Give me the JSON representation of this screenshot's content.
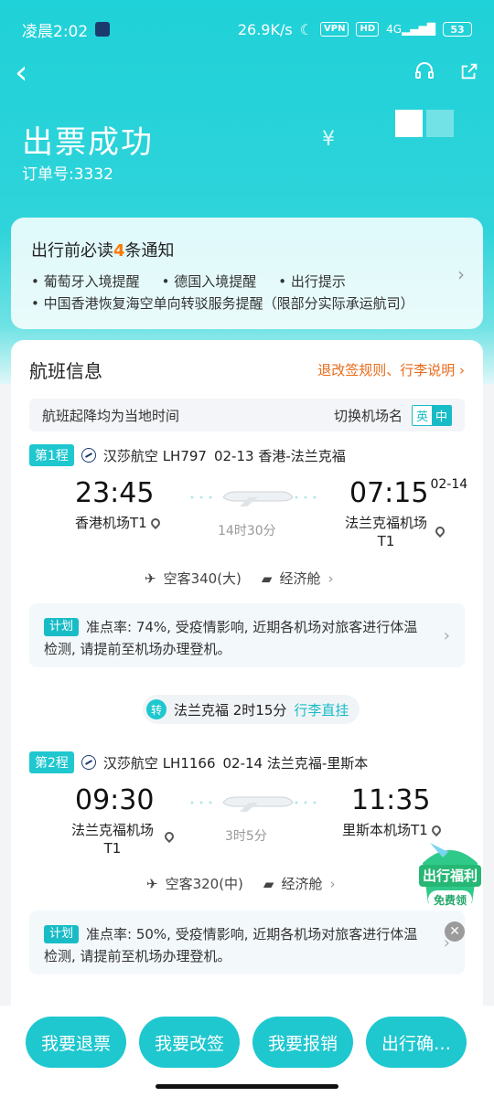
{
  "status_bar": {
    "time": "凌晨2:02",
    "speed": "26.9K/s",
    "vpn": "VPN",
    "hd": "HD",
    "network": "4G",
    "battery": "53"
  },
  "header": {
    "title": "出票成功",
    "order_label": "订单号:3332",
    "price_symbol": "¥"
  },
  "notice": {
    "title_prefix": "出行前必读",
    "title_count": "4",
    "title_suffix": "条通知",
    "items": [
      "• 葡萄牙入境提醒",
      "• 德国入境提醒",
      "• 出行提示"
    ],
    "item_long": "• 中国香港恢复海空单向转驳服务提醒（限部分实际承运航司）"
  },
  "flight_card": {
    "title": "航班信息",
    "rules_link": "退改签规则、行李说明 ›",
    "tip": "航班起降均为当地时间",
    "switch_label": "切换机场名",
    "lang_en": "英",
    "lang_zh": "中"
  },
  "legs": [
    {
      "tag": "第1程",
      "airline": "汉莎航空 LH797",
      "date_route": "02-13 香港-法兰克福",
      "dep_time": "23:45",
      "arr_time": "07:15",
      "arr_date": "02-14",
      "dep_airport": "香港机场T1",
      "arr_airport_line1": "法兰克福机场",
      "arr_airport_line2": "T1",
      "duration": "14时30分",
      "aircraft": "空客340(大)",
      "cabin": "经济舱",
      "plan_tag": "计划",
      "plan_text": "准点率: 74%, 受疫情影响, 近期各机场对旅客进行体温检测, 请提前至机场办理登机。"
    },
    {
      "tag": "第2程",
      "airline": "汉莎航空 LH1166",
      "date_route": "02-14 法兰克福-里斯本",
      "dep_time": "09:30",
      "arr_time": "11:35",
      "dep_airport_line1": "法兰克福机场",
      "dep_airport_line2": "T1",
      "arr_airport": "里斯本机场T1",
      "duration": "3时5分",
      "aircraft": "空客320(中)",
      "cabin": "经济舱",
      "plan_tag": "计划",
      "plan_text": "准点率: 50%, 受疫情影响, 近期各机场对旅客进行体温检测, 请提前至机场办理登机。"
    }
  ],
  "transfer": {
    "icon_text": "转",
    "text": "法兰克福 2时15分",
    "bag": "行李直挂"
  },
  "promo": {
    "line1": "出行福利",
    "line2": "免费领"
  },
  "buttons": [
    "我要退票",
    "我要改签",
    "我要报销",
    "出行确…"
  ],
  "colors": {
    "accent": "#1fc7cf",
    "link_orange": "#e86a17",
    "highlight_orange": "#ff7a00"
  }
}
